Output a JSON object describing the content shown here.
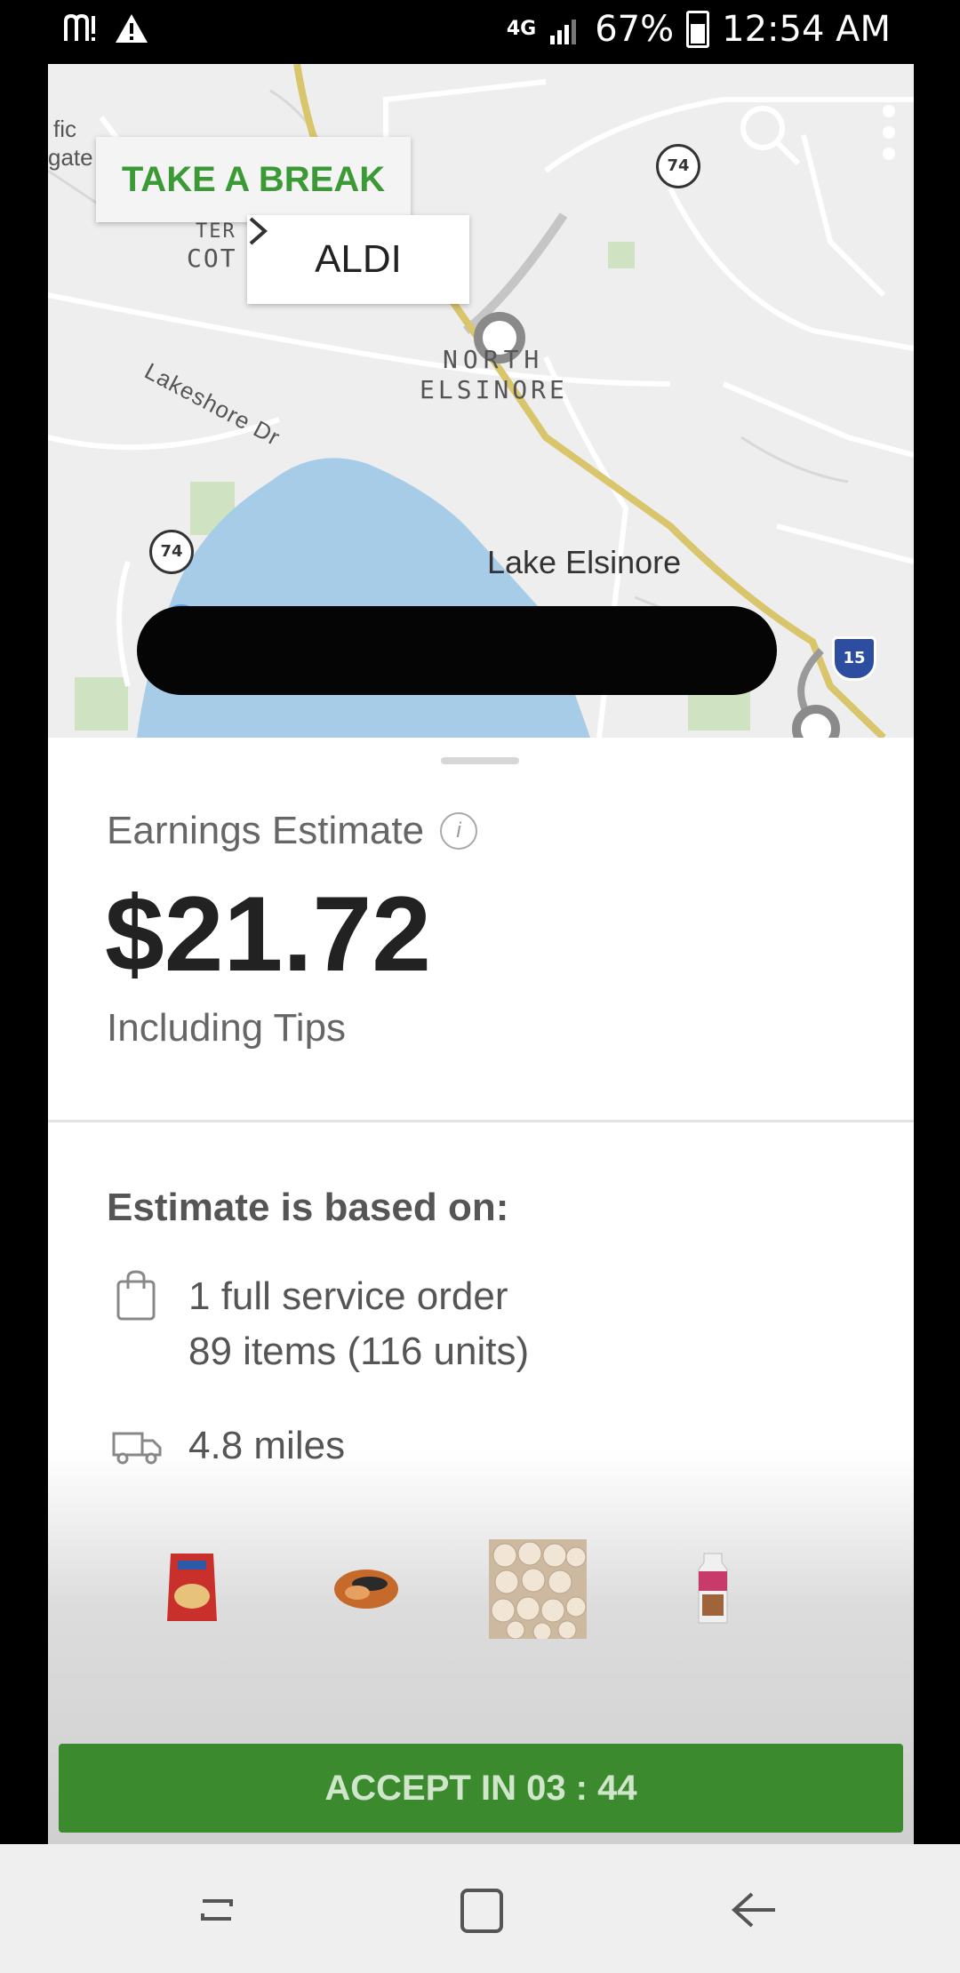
{
  "status_bar": {
    "network": "4G",
    "battery": "67%",
    "time": "12:54 AM"
  },
  "map": {
    "take_break_label": "TAKE A BREAK",
    "store_name": "ALDI",
    "place_labels": {
      "north_1": "NORTH",
      "north_2": "ELSINORE",
      "street": "Lakeshore Dr",
      "lake": "Lake Elsinore",
      "fic": "fic",
      "gate": "gate",
      "ter": "TER",
      "cot": "COT"
    },
    "route_shields": [
      "74",
      "74",
      "15"
    ]
  },
  "earnings": {
    "label": "Earnings Estimate",
    "amount": "$21.72",
    "sub": "Including Tips"
  },
  "basis": {
    "title": "Estimate is based on:",
    "order_line_1": "1 full service order",
    "order_line_2": "89 items (116 units)",
    "distance": "4.8 miles"
  },
  "accept": {
    "label": "ACCEPT IN 03 : 44"
  },
  "colors": {
    "brand_green": "#3b9a36",
    "accept_green": "#3c8a2e",
    "highway": "#d9c56b"
  },
  "icons": [
    "search-icon",
    "more-vert-icon",
    "chevron-right-icon",
    "info-icon",
    "shopping-bag-icon",
    "delivery-truck-icon",
    "recents-nav-icon",
    "home-nav-icon",
    "back-nav-icon"
  ]
}
